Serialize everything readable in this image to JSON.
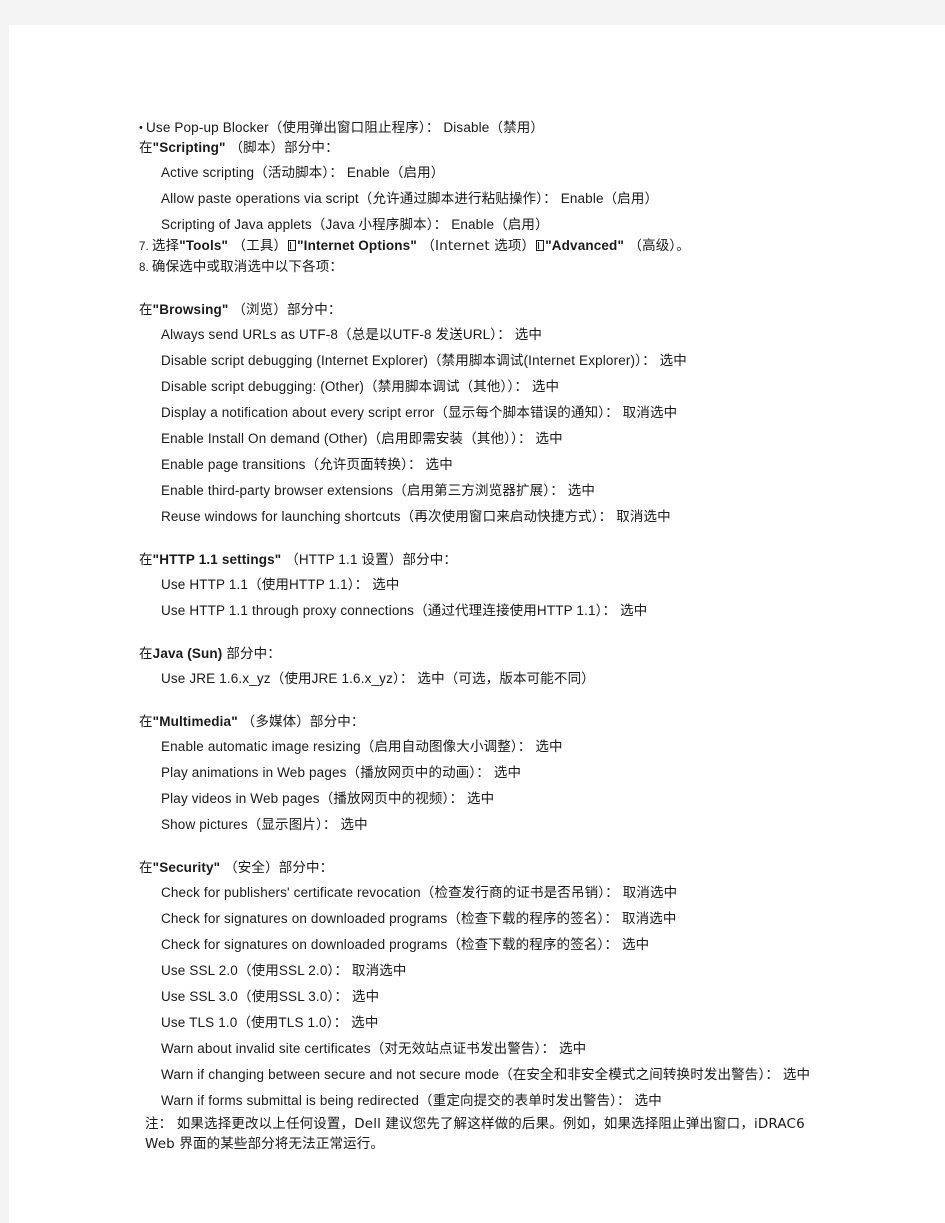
{
  "document": {
    "page_background": "#ffffff",
    "edge_color": "#f4f4f4",
    "text_color": "#1a1a1a"
  },
  "blocks": [
    {
      "id": "popup_blocker",
      "marker": "•",
      "text": "Use Pop-up Blocker（使用弹出窗口阻止程序）： Disable（禁用）"
    },
    {
      "id": "scripting_heading",
      "prefix": "在",
      "bold": "\"Scripting\"",
      "suffix": " （脚本）部分中："
    },
    {
      "id": "active_scripting",
      "text": "Active scripting（活动脚本）： Enable（启用）"
    },
    {
      "id": "allow_paste",
      "text": "Allow paste operations via script（允许通过脚本进行粘贴操作）： Enable（启用）"
    },
    {
      "id": "java_applets",
      "text": "Scripting of Java applets（Java 小程序脚本）： Enable（启用）"
    },
    {
      "id": "step7",
      "number": "7.",
      "parts": [
        {
          "t": "选择",
          "bold": false
        },
        {
          "t": "\"Tools\"",
          "bold": true
        },
        {
          "t": " （工具）",
          "bold": false
        },
        {
          "t": "TOFU",
          "bold": false
        },
        {
          "t": "\"Internet Options\"",
          "bold": true
        },
        {
          "t": " （Internet 选项）",
          "bold": false
        },
        {
          "t": "TOFU",
          "bold": false
        },
        {
          "t": "\"Advanced\"",
          "bold": true
        },
        {
          "t": " （高级）。",
          "bold": false
        }
      ]
    },
    {
      "id": "step8",
      "number": "8.",
      "text": "确保选中或取消选中以下各项："
    },
    {
      "id": "browsing_heading",
      "prefix": "在",
      "bold": "\"Browsing\"",
      "suffix": " （浏览）部分中："
    },
    {
      "id": "b1",
      "text": "Always send URLs as UTF-8（总是以UTF-8 发送URL）： 选中"
    },
    {
      "id": "b2",
      "text": "Disable script debugging (Internet Explorer)（禁用脚本调试(Internet Explorer)）： 选中"
    },
    {
      "id": "b3",
      "text": "Disable script debugging: (Other)（禁用脚本调试（其他））： 选中"
    },
    {
      "id": "b4",
      "text": "Display a notification about every script error（显示每个脚本错误的通知）： 取消选中"
    },
    {
      "id": "b5",
      "text": "Enable Install On demand (Other)（启用即需安装（其他））： 选中"
    },
    {
      "id": "b6",
      "text": "Enable page transitions（允许页面转换）： 选中"
    },
    {
      "id": "b7",
      "text": "Enable third-party browser extensions（启用第三方浏览器扩展）： 选中"
    },
    {
      "id": "b8",
      "text": "Reuse windows for launching shortcuts（再次使用窗口来启动快捷方式）： 取消选中"
    },
    {
      "id": "http_heading",
      "prefix": "在",
      "bold": "\"HTTP 1.1 settings\"",
      "suffix": " （HTTP 1.1 设置）部分中："
    },
    {
      "id": "h1",
      "text": "Use HTTP 1.1（使用HTTP 1.1）： 选中"
    },
    {
      "id": "h2",
      "text": "Use HTTP 1.1 through proxy connections（通过代理连接使用HTTP 1.1）： 选中"
    },
    {
      "id": "java_heading",
      "prefix": "在",
      "bold": "Java (Sun)",
      "suffix": " 部分中："
    },
    {
      "id": "j1",
      "text": "Use JRE 1.6.x_yz（使用JRE 1.6.x_yz）： 选中（可选，版本可能不同）"
    },
    {
      "id": "multimedia_heading",
      "prefix": "在",
      "bold": "\"Multimedia\"",
      "suffix": " （多媒体）部分中："
    },
    {
      "id": "m1",
      "text": "Enable automatic image resizing（启用自动图像大小调整）： 选中"
    },
    {
      "id": "m2",
      "text": "Play animations in Web pages（播放网页中的动画）： 选中"
    },
    {
      "id": "m3",
      "text": "Play videos in Web pages（播放网页中的视频）： 选中"
    },
    {
      "id": "m4",
      "text": "Show pictures（显示图片）： 选中"
    },
    {
      "id": "security_heading",
      "prefix": "在",
      "bold": "\"Security\"",
      "suffix": " （安全）部分中："
    },
    {
      "id": "s1",
      "text": "Check for publishers' certificate revocation（检查发行商的证书是否吊销）： 取消选中"
    },
    {
      "id": "s2",
      "text": "Check for signatures on downloaded programs（检查下载的程序的签名）： 取消选中"
    },
    {
      "id": "s3",
      "text": "Check for signatures on downloaded programs（检查下载的程序的签名）： 选中"
    },
    {
      "id": "s4",
      "text": "Use SSL 2.0（使用SSL 2.0）： 取消选中"
    },
    {
      "id": "s5",
      "text": "Use SSL 3.0（使用SSL 3.0）： 选中"
    },
    {
      "id": "s6",
      "text": "Use TLS 1.0（使用TLS 1.0）： 选中"
    },
    {
      "id": "s7",
      "text": "Warn about invalid site certificates（对无效站点证书发出警告）： 选中"
    },
    {
      "id": "s8",
      "text": "Warn if changing between secure and not secure mode（在安全和非安全模式之间转换时发出警告）： 选中"
    },
    {
      "id": "s9",
      "text": "Warn if forms submittal is being redirected（重定向提交的表单时发出警告）： 选中"
    },
    {
      "id": "note",
      "text": "注： 如果选择更改以上任何设置，Dell 建议您先了解这样做的后果。例如，如果选择阻止弹出窗口，iDRAC6 Web 界面的某些部分将无法正常运行。"
    }
  ]
}
